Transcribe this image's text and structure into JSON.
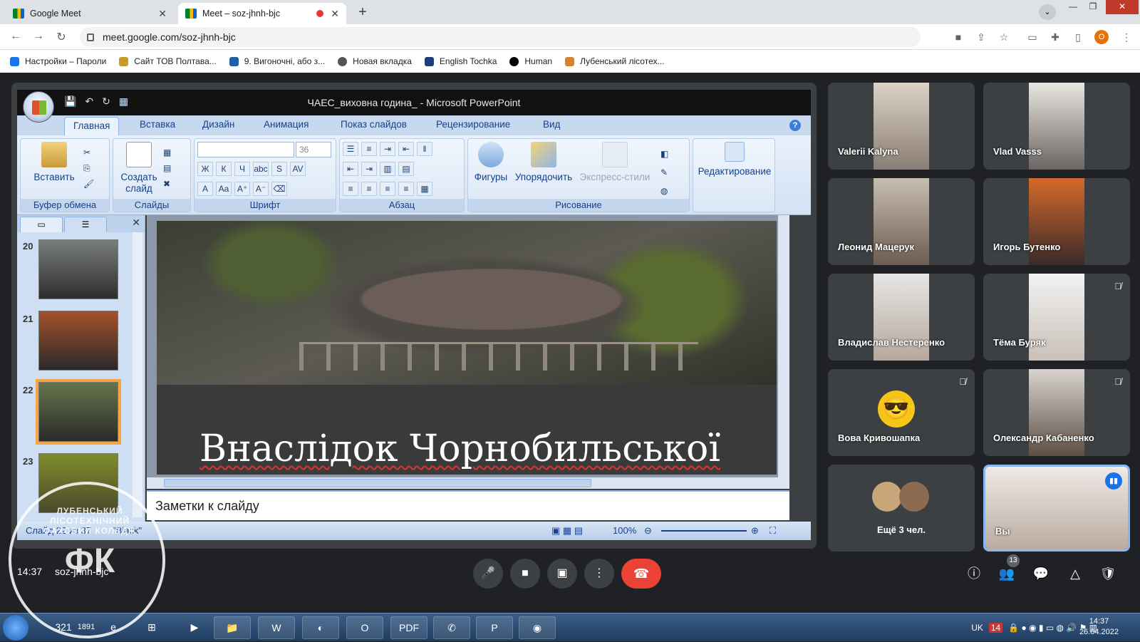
{
  "browser": {
    "tabs": [
      {
        "title": "Google Meet"
      },
      {
        "title": "Meet – soz-jhnh-bjc"
      }
    ],
    "url": "meet.google.com/soz-jhnh-bjc",
    "profile_initial": "O",
    "bookmarks": [
      "Настройки – Пароли",
      "Сайт ТОВ Полтава...",
      "9. Вигонoчні, або з...",
      "Новая вкладка",
      "English Tochka",
      "Human",
      "Лубенський лісотех..."
    ]
  },
  "powerpoint": {
    "window_title": "ЧАЕС_виховна година_ - Microsoft PowerPoint",
    "ribbon_tabs": [
      "Главная",
      "Вставка",
      "Дизайн",
      "Анимация",
      "Показ слайдов",
      "Рецензирование",
      "Вид"
    ],
    "groups": {
      "clipboard": "Буфер обмена",
      "slides": "Слайды",
      "font": "Шрифт",
      "paragraph": "Абзац",
      "drawing": "Рисование"
    },
    "buttons": {
      "paste": "Вставить",
      "new_slide_1": "Создать",
      "new_slide_2": "слайд",
      "shapes": "Фигуры",
      "arrange": "Упорядочить",
      "quick_styles": "Экспресс-стили",
      "editing": "Редактирование"
    },
    "font_size": "36",
    "slide_numbers": [
      "20",
      "21",
      "22",
      "23"
    ],
    "slide_title": "Внаслідок   Чорнобильської",
    "notes_placeholder": "Заметки к слайду",
    "status_slide": "Слайд 22 из 37",
    "status_theme": "\"Black\"",
    "zoom": "100%"
  },
  "meet": {
    "participants": [
      {
        "name": "Valerii Kalyna",
        "muted": false
      },
      {
        "name": "Vlad Vasss",
        "muted": false
      },
      {
        "name": "Леонид Мацерук",
        "muted": false
      },
      {
        "name": "Игорь Бутенко",
        "muted": false
      },
      {
        "name": "Владислав Нестеренко",
        "muted": false
      },
      {
        "name": "Тёма Буряк",
        "muted": true
      },
      {
        "name": "Вова Кривошапка",
        "muted": true
      },
      {
        "name": "Олександр Кабаненко",
        "muted": true
      }
    ],
    "more_label": "Ещё 3 чел.",
    "self_label": "Вы",
    "time": "14:37",
    "meeting_code": "soz-jhnh-bjc",
    "people_count": "13"
  },
  "watermark": {
    "ring_text": "ЛУБЕНСЬКИЙ ЛІСОТЕХНІЧНИЙ ФАХОВИЙ КОЛЕДЖ",
    "logo": "ФК"
  },
  "taskbar": {
    "lang": "UK",
    "tray_badge": "14",
    "clock_time": "14:37",
    "clock_date": "26.04.2022",
    "app_badges": {
      "calendar": "321",
      "k": "1891"
    }
  }
}
